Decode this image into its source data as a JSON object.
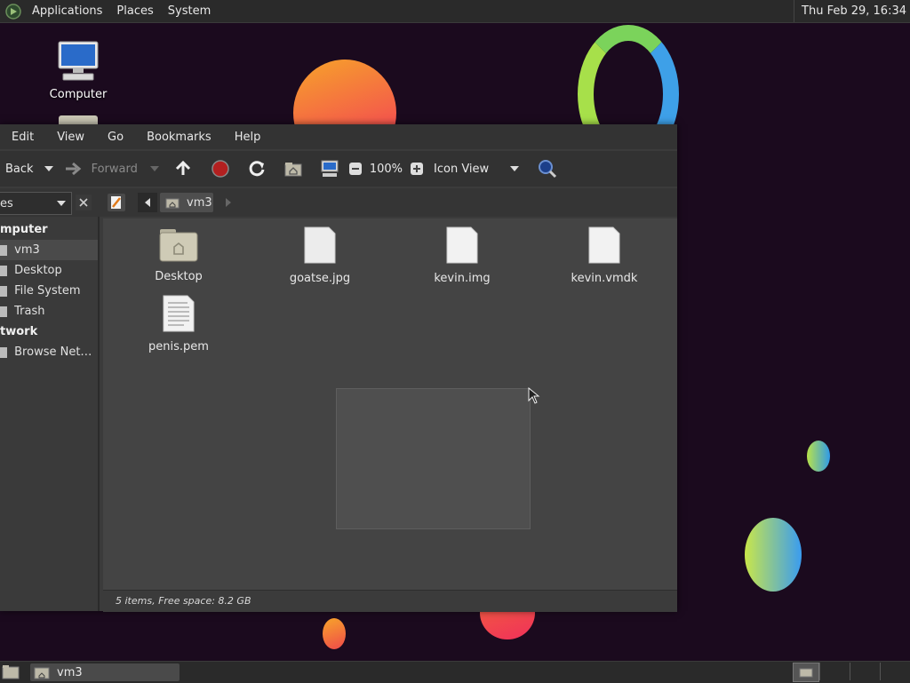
{
  "top_panel": {
    "menus": [
      "Applications",
      "Places",
      "System"
    ],
    "clock": "Thu Feb 29, 16:34"
  },
  "desktop": {
    "icons": [
      {
        "label": "Computer",
        "icon": "computer-icon"
      }
    ]
  },
  "window": {
    "menubar": [
      "Edit",
      "View",
      "Go",
      "Bookmarks",
      "Help"
    ],
    "toolbar": {
      "back_label": "Back",
      "forward_label": "Forward",
      "zoom_level": "100%",
      "view_mode": "Icon View"
    },
    "location": {
      "current_folder": "vm3"
    },
    "sidebar": {
      "selector_label": "es",
      "items": [
        {
          "label": "mputer",
          "type": "header"
        },
        {
          "label": "vm3",
          "type": "item",
          "icon": "home-icon"
        },
        {
          "label": "Desktop",
          "type": "item",
          "icon": "desktop-icon"
        },
        {
          "label": "File System",
          "type": "item",
          "icon": "drive-icon"
        },
        {
          "label": "Trash",
          "type": "item",
          "icon": "trash-icon"
        },
        {
          "label": "twork",
          "type": "header"
        },
        {
          "label": "Browse Net…",
          "type": "item",
          "icon": "network-icon"
        }
      ]
    },
    "files": [
      {
        "name": "Desktop",
        "icon": "folder-icon"
      },
      {
        "name": "goatse.jpg",
        "icon": "file-icon"
      },
      {
        "name": "kevin.img",
        "icon": "file-icon"
      },
      {
        "name": "kevin.vmdk",
        "icon": "file-icon"
      },
      {
        "name": "penis.pem",
        "icon": "text-file-icon"
      }
    ],
    "status": "5 items, Free space: 8.2 GB"
  },
  "bottom_panel": {
    "task_label": "vm3"
  },
  "colors": {
    "desktop_bg": "#1b0a1e",
    "panel_bg": "#2a2a2a",
    "window_bg": "#3b3b3b",
    "content_bg": "#444444"
  }
}
